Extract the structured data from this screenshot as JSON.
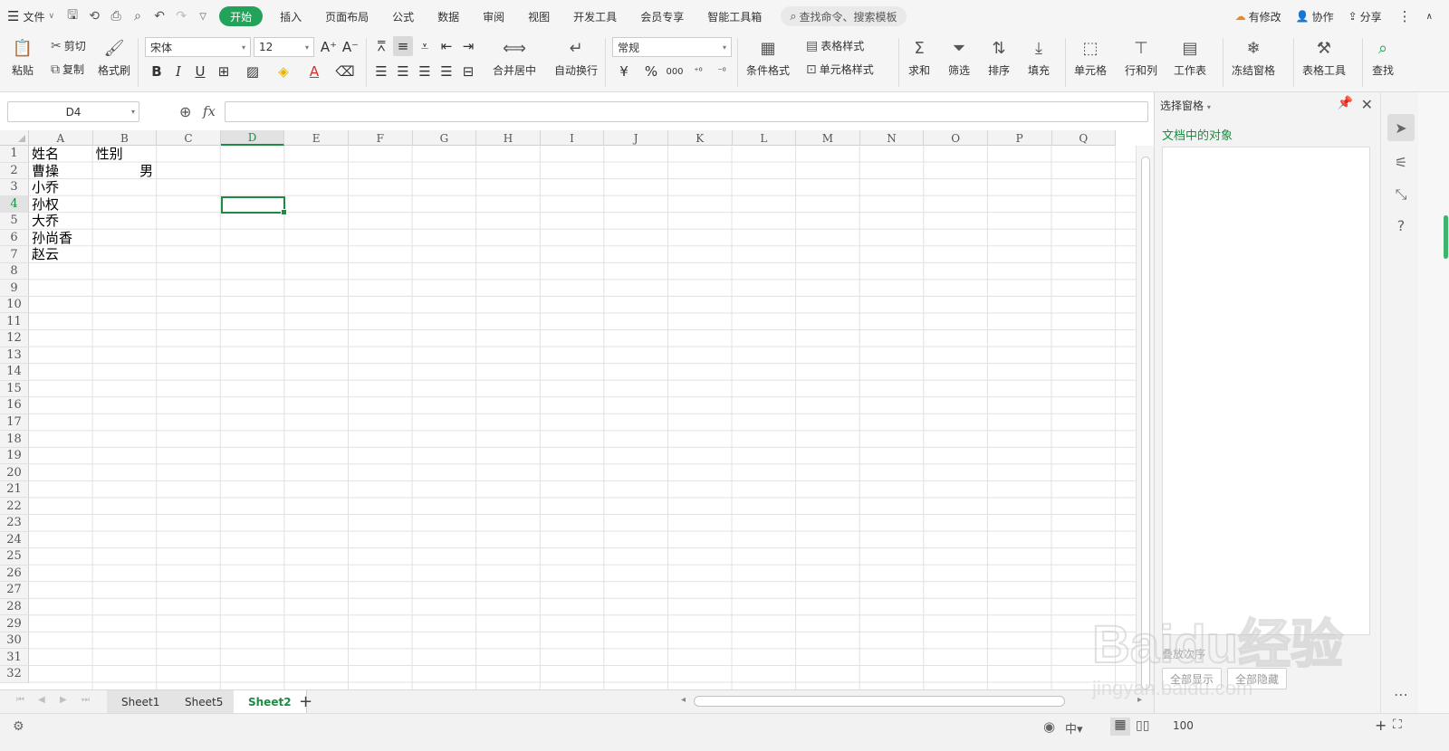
{
  "menubar": {
    "file_label": "文件",
    "tabs": [
      "开始",
      "插入",
      "页面布局",
      "公式",
      "数据",
      "审阅",
      "视图",
      "开发工具",
      "会员专享",
      "智能工具箱"
    ],
    "search_placeholder": "查找命令、搜索模板",
    "right": {
      "modified": "有修改",
      "collab": "协作",
      "share": "分享"
    }
  },
  "ribbon": {
    "paste": "粘贴",
    "cut": "剪切",
    "copy": "复制",
    "format_painter": "格式刷",
    "font_name": "宋体",
    "font_size": "12",
    "number_format": "常规",
    "merge_center": "合并居中",
    "wrap_text": "自动换行",
    "cond_format": "条件格式",
    "table_style": "表格样式",
    "cell_style": "单元格样式",
    "sum": "求和",
    "filter": "筛选",
    "sort": "排序",
    "fill": "填充",
    "cell": "单元格",
    "rowcol": "行和列",
    "worksheet": "工作表",
    "freeze": "冻结窗格",
    "table_tools": "表格工具",
    "find": "查找",
    "currency_symbol": "¥",
    "percent_symbol": "%",
    "thousands_symbol": "000"
  },
  "formula_bar": {
    "name_box": "D4",
    "fx": "fx",
    "formula": ""
  },
  "sheet": {
    "columns": [
      "A",
      "B",
      "C",
      "D",
      "E",
      "F",
      "G",
      "H",
      "I",
      "J",
      "K",
      "L",
      "M",
      "N",
      "O",
      "P",
      "Q"
    ],
    "selected_column": "D",
    "selected_row": 4,
    "selected_cell": "D4",
    "row_count": 32,
    "rows": [
      "1",
      "2",
      "3",
      "4",
      "5",
      "6",
      "7",
      "8",
      "9",
      "10",
      "11",
      "12",
      "13",
      "14",
      "15",
      "16",
      "17",
      "18",
      "19",
      "20",
      "21",
      "22",
      "23",
      "24",
      "25",
      "26",
      "27",
      "28",
      "29",
      "30",
      "31",
      "32"
    ],
    "cells": {
      "A1": "姓名",
      "B1": "性别",
      "A2": "曹操",
      "B2": "男",
      "A3": "小乔",
      "A4": "孙权",
      "A5": "大乔",
      "A6": "孙尚香",
      "A7": "赵云"
    }
  },
  "sheet_tabs": [
    "Sheet1",
    "Sheet5",
    "Sheet2"
  ],
  "active_sheet": "Sheet2",
  "status": {
    "zoom": "100"
  },
  "selection_pane": {
    "title": "选择窗格",
    "subtitle": "文档中的对象",
    "show_all": "全部显示",
    "hide_all": "全部隐藏",
    "sort_label": "叠放次序"
  },
  "watermark": {
    "brand": "Baidu经验",
    "url": "jingyan.baidu.com"
  },
  "colors": {
    "accent": "#23a35a",
    "grid": "#e1e1e1",
    "selection": "#1e8a44"
  }
}
